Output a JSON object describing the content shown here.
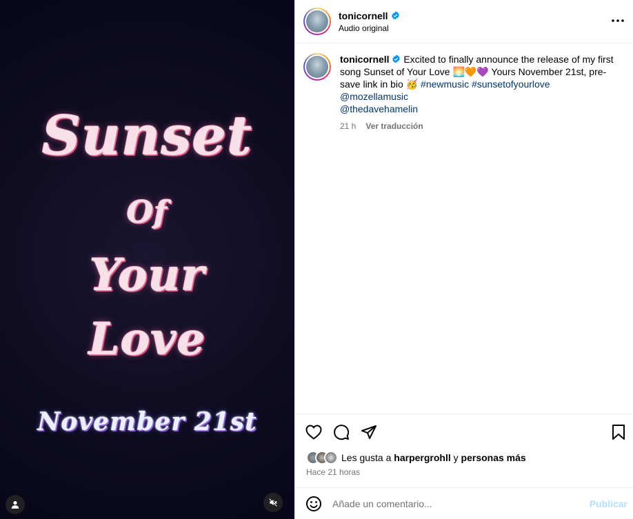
{
  "media": {
    "lines": [
      "Sunset",
      "Of",
      "Your",
      "Love",
      "November 21st"
    ],
    "profile_icon": "user-icon",
    "mute_icon": "mute-icon"
  },
  "header": {
    "username": "tonicornell",
    "subtitle": "Audio original",
    "more_icon": "more-icon"
  },
  "caption": {
    "username": "tonicornell",
    "text_before_emojis": "Excited to finally announce the release of my first song Sunset of Your Love",
    "emojis_1": "🌅🧡💜",
    "text_after_emojis": "Yours November 21st, pre-save link in bio",
    "emoji_2": "🥳",
    "hashtags": [
      "#newmusic",
      "#sunsetofyourlove"
    ],
    "mentions": [
      "@mozellamusic",
      "@thedavehamelin"
    ],
    "time_ago": "21 h",
    "translate_label": "Ver traducción"
  },
  "actions": {
    "like_icon": "heart-icon",
    "comment_icon": "comment-icon",
    "share_icon": "share-icon",
    "save_icon": "bookmark-icon"
  },
  "likes": {
    "prefix": "Les gusta a",
    "user": "harpergrohll",
    "connector": "y",
    "others": "personas más"
  },
  "posted": "Hace 21 horas",
  "comment": {
    "placeholder": "Añade un comentario...",
    "post_label": "Publicar",
    "emoji_icon": "smiley-icon"
  },
  "colors": {
    "link": "#00376b",
    "verified": "#0095f6",
    "post_disabled": "#b2dffc",
    "muted_text": "#737373"
  }
}
